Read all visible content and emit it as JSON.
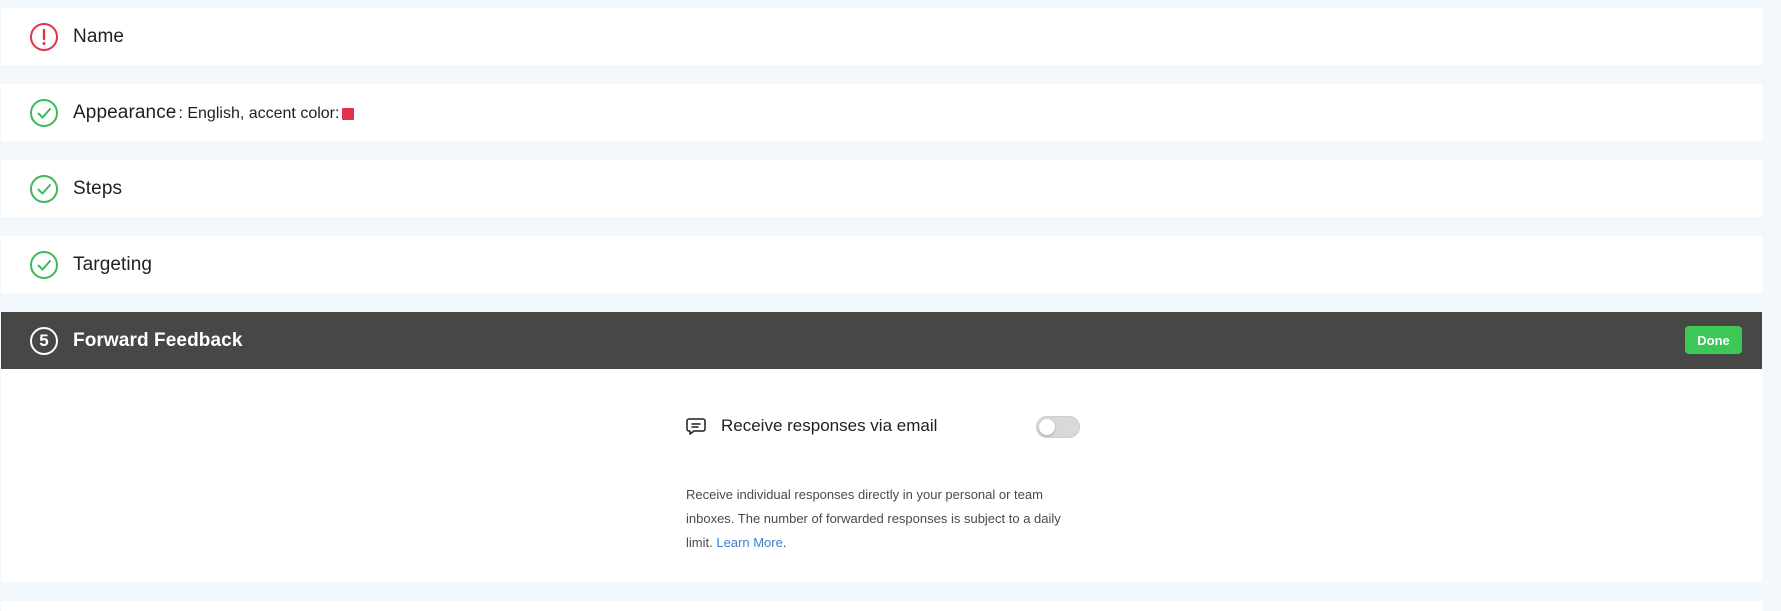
{
  "steps": [
    {
      "title": "Name",
      "status": "error",
      "icon": "alert-circle-icon"
    },
    {
      "title": "Appearance",
      "subtitle": ": English, accent color:",
      "accent_color": "#e2324a",
      "status": "complete",
      "icon": "check-circle-icon"
    },
    {
      "title": "Steps",
      "status": "complete",
      "icon": "check-circle-icon"
    },
    {
      "title": "Targeting",
      "status": "complete",
      "icon": "check-circle-icon"
    }
  ],
  "active_step": {
    "number": "5",
    "title": "Forward Feedback",
    "done_label": "Done"
  },
  "forward_feedback": {
    "email_label": "Receive responses via email",
    "email_enabled": false,
    "description": "Receive individual responses directly in your personal or team inboxes. The number of forwarded responses is subject to a daily limit. ",
    "learn_more_label": "Learn More",
    "description_end": "."
  },
  "colors": {
    "error": "#e2324a",
    "success": "#3cb95a",
    "active_bar": "#474745",
    "done_button": "#3cc756",
    "link": "#3b7fcf",
    "page_bg": "#f3f8fd"
  }
}
